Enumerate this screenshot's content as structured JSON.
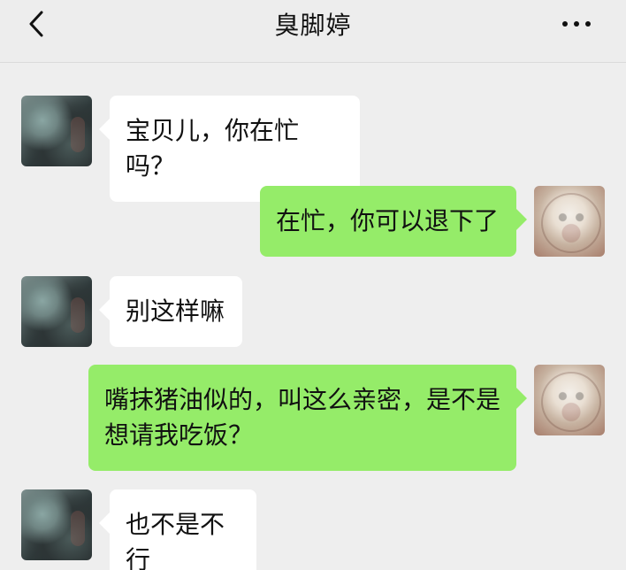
{
  "header": {
    "title": "臭脚婷",
    "back_icon": "chevron-left-icon",
    "more_icon": "more-horizontal-icon"
  },
  "messages": [
    {
      "side": "left",
      "text": "宝贝儿，你在忙吗？"
    },
    {
      "side": "right",
      "text": "在忙，你可以退下了"
    },
    {
      "side": "left",
      "text": "别这样嘛"
    },
    {
      "side": "right",
      "text": "嘴抹猪油似的，叫这么亲密，是不是\n想请我吃饭？"
    },
    {
      "side": "left",
      "text": "也不是不行"
    }
  ],
  "colors": {
    "background": "#eeeeee",
    "header_background": "#ededed",
    "incoming_bubble": "#ffffff",
    "outgoing_bubble": "#95ec69",
    "text": "#111111"
  }
}
